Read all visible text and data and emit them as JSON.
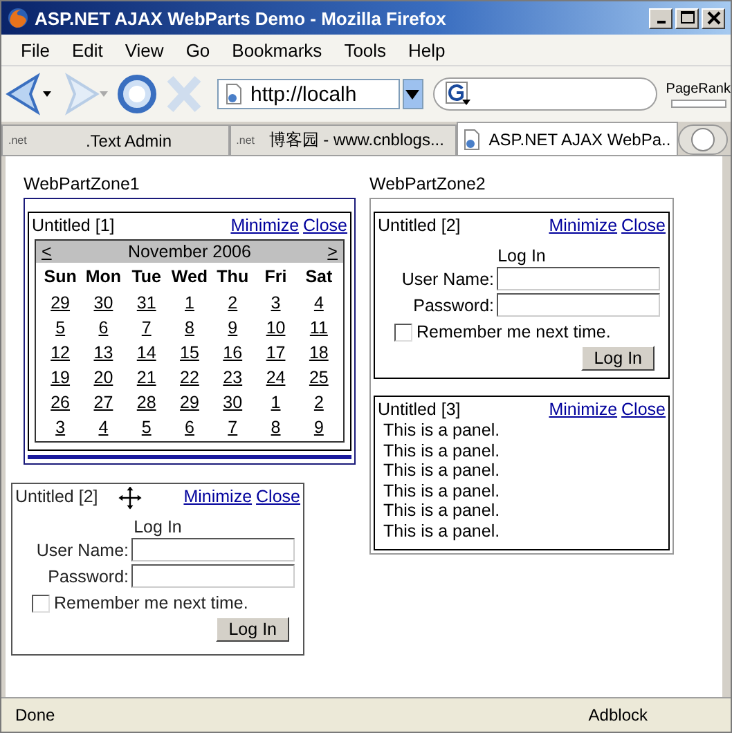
{
  "window": {
    "title": "ASP.NET AJAX WebParts Demo - Mozilla Firefox"
  },
  "menu": [
    "File",
    "Edit",
    "View",
    "Go",
    "Bookmarks",
    "Tools",
    "Help"
  ],
  "toolbar": {
    "address": "http://localh",
    "pagerank_label": "PageRank"
  },
  "tabs": [
    {
      "favicon_text": ".net",
      "label": ".Text Admin",
      "selected": false
    },
    {
      "favicon_text": ".net",
      "label": "博客园 - www.cnblogs...",
      "selected": false
    },
    {
      "label": "ASP.NET AJAX WebPa...",
      "selected": true
    }
  ],
  "zones": [
    {
      "title": "WebPartZone1",
      "drop_indicator": true,
      "parts": [
        {
          "kind": "calendar",
          "title": "Untitled [1]",
          "verbs": [
            "Minimize",
            "Close"
          ],
          "calendar": {
            "prev": "<",
            "month": "November 2006",
            "next": ">",
            "day_names": [
              "Sun",
              "Mon",
              "Tue",
              "Wed",
              "Thu",
              "Fri",
              "Sat"
            ],
            "weeks": [
              [
                "29",
                "30",
                "31",
                "1",
                "2",
                "3",
                "4"
              ],
              [
                "5",
                "6",
                "7",
                "8",
                "9",
                "10",
                "11"
              ],
              [
                "12",
                "13",
                "14",
                "15",
                "16",
                "17",
                "18"
              ],
              [
                "19",
                "20",
                "21",
                "22",
                "23",
                "24",
                "25"
              ],
              [
                "26",
                "27",
                "28",
                "29",
                "30",
                "1",
                "2"
              ],
              [
                "3",
                "4",
                "5",
                "6",
                "7",
                "8",
                "9"
              ]
            ]
          }
        }
      ]
    },
    {
      "title": "WebPartZone2",
      "drop_indicator": false,
      "parts": [
        {
          "kind": "login",
          "title": "Untitled [2]",
          "verbs": [
            "Minimize",
            "Close"
          ],
          "login": {
            "heading": "Log In",
            "user_label": "User Name:",
            "password_label": "Password:",
            "remember_label": "Remember me next time.",
            "remember_checked": false,
            "button": "Log In"
          }
        },
        {
          "kind": "panel",
          "title": "Untitled [3]",
          "verbs": [
            "Minimize",
            "Close"
          ],
          "lines": [
            "This is a panel.",
            "This is a panel.",
            "This is a panel.",
            "This is a panel.",
            "This is a panel.",
            "This is a panel."
          ]
        }
      ]
    }
  ],
  "dragging_part": {
    "kind": "login",
    "title": "Untitled [2]",
    "verbs": [
      "Minimize",
      "Close"
    ],
    "login": {
      "heading": "Log In",
      "user_label": "User Name:",
      "password_label": "Password:",
      "remember_label": "Remember me next time.",
      "remember_checked": false,
      "button": "Log In"
    }
  },
  "status_bar": {
    "text": "Done",
    "addon": "Adblock"
  }
}
